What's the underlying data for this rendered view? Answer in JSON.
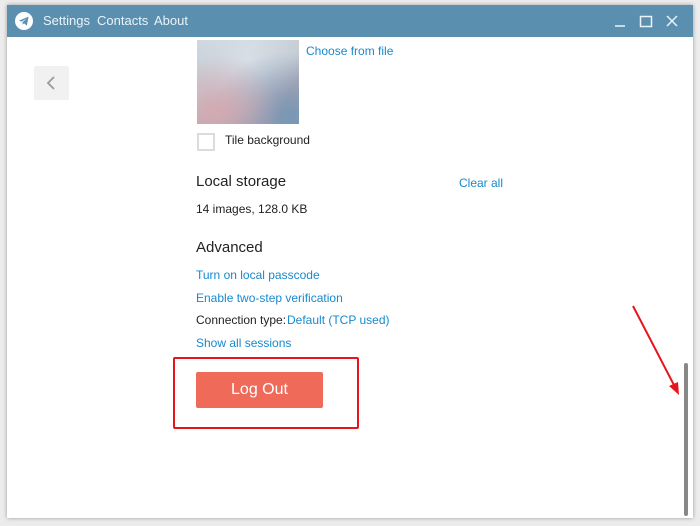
{
  "titlebar": {
    "menu": [
      "Settings",
      "Contacts",
      "About"
    ],
    "controls": [
      "minimize",
      "maximize",
      "close"
    ]
  },
  "background": {
    "choose_from_file": "Choose from file",
    "tile_background_label": "Tile background",
    "tile_background_checked": false
  },
  "local_storage": {
    "title": "Local storage",
    "clear_all": "Clear all",
    "summary": "14 images, 128.0 KB"
  },
  "advanced": {
    "title": "Advanced",
    "local_passcode": "Turn on local passcode",
    "two_step": "Enable two-step verification",
    "connection_type_label": "Connection type:",
    "connection_type_value": "Default (TCP used)",
    "show_sessions": "Show all sessions"
  },
  "logout": {
    "label": "Log Out"
  },
  "colors": {
    "titlebar": "#5a8fb0",
    "link": "#168acd",
    "logout": "#f06a5a",
    "annotation": "#e8141c"
  }
}
